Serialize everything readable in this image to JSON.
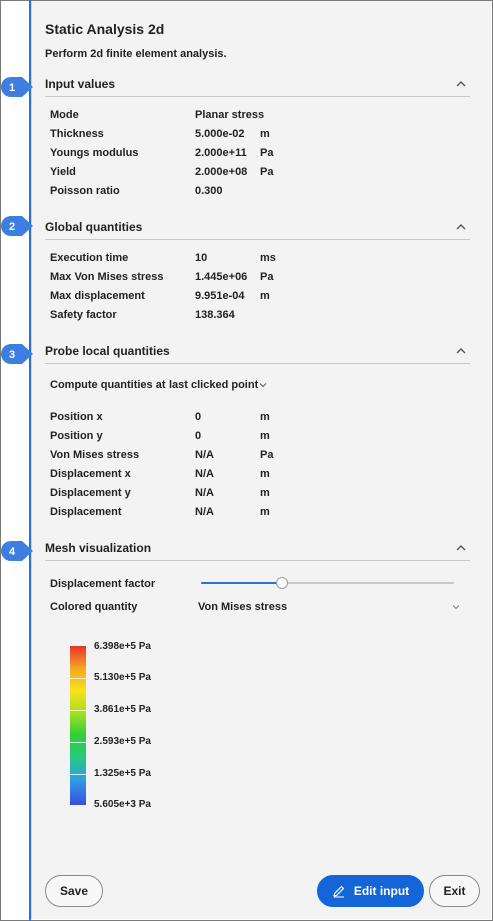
{
  "header": {
    "title": "Static Analysis 2d",
    "subtitle": "Perform 2d finite element analysis."
  },
  "callouts": [
    "1",
    "2",
    "3",
    "4"
  ],
  "sections": {
    "input_values": {
      "title": "Input values",
      "rows": [
        {
          "label": "Mode",
          "value": "Planar stress",
          "unit": ""
        },
        {
          "label": "Thickness",
          "value": "5.000e-02",
          "unit": "m"
        },
        {
          "label": "Youngs modulus",
          "value": "2.000e+11",
          "unit": "Pa"
        },
        {
          "label": "Yield",
          "value": "2.000e+08",
          "unit": "Pa"
        },
        {
          "label": "Poisson ratio",
          "value": "0.300",
          "unit": ""
        }
      ]
    },
    "global_quantities": {
      "title": "Global quantities",
      "rows": [
        {
          "label": "Execution time",
          "value": "10",
          "unit": "ms"
        },
        {
          "label": "Max Von Mises stress",
          "value": "1.445e+06",
          "unit": "Pa"
        },
        {
          "label": "Max displacement",
          "value": "9.951e-04",
          "unit": "m"
        },
        {
          "label": "Safety factor",
          "value": "138.364",
          "unit": ""
        }
      ]
    },
    "probe_local": {
      "title": "Probe local quantities",
      "compute_label": "Compute quantities at",
      "compute_value": "last clicked point",
      "rows": [
        {
          "label": "Position x",
          "value": "0",
          "unit": "m"
        },
        {
          "label": "Position y",
          "value": "0",
          "unit": "m"
        },
        {
          "label": "Von Mises stress",
          "value": "N/A",
          "unit": "Pa"
        },
        {
          "label": "Displacement x",
          "value": "N/A",
          "unit": "m"
        },
        {
          "label": "Displacement y",
          "value": "N/A",
          "unit": "m"
        },
        {
          "label": "Displacement",
          "value": "N/A",
          "unit": "m"
        }
      ]
    },
    "mesh_visualization": {
      "title": "Mesh visualization",
      "displacement_factor_label": "Displacement factor",
      "displacement_factor_level": 0.32,
      "colored_quantity_label": "Colored quantity",
      "colored_quantity_value": "Von Mises stress",
      "colorbar_labels": [
        "6.398e+5 Pa",
        "5.130e+5 Pa",
        "3.861e+5 Pa",
        "2.593e+5 Pa",
        "1.325e+5 Pa",
        "5.605e+3 Pa"
      ]
    }
  },
  "footer": {
    "save_label": "Save",
    "edit_label": "Edit input",
    "exit_label": "Exit"
  },
  "colors": {
    "accent": "#1466d8",
    "callout": "#3d7fe0"
  }
}
